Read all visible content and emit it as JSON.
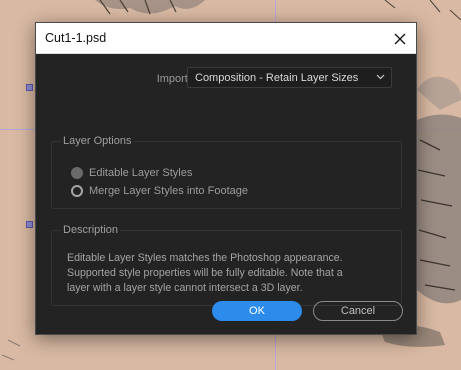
{
  "dialog": {
    "title": "Cut1-1.psd",
    "close_icon": "close-icon",
    "import_kind": {
      "label": "Import Kind:",
      "selected": "Composition - Retain Layer Sizes",
      "chevron_icon": "chevron-down-icon"
    },
    "layer_options": {
      "title": "Layer Options",
      "options": [
        {
          "label": "Editable Layer Styles",
          "state": "disabled-selected"
        },
        {
          "label": "Merge Layer Styles into Footage",
          "state": "unselected"
        }
      ]
    },
    "description": {
      "title": "Description",
      "lines": [
        "Editable Layer Styles matches the Photoshop appearance.",
        "Supported style properties will be fully editable. Note that a",
        "layer with a layer style cannot intersect a 3D layer."
      ]
    },
    "buttons": {
      "ok": "OK",
      "cancel": "Cancel"
    }
  },
  "colors": {
    "canvas_background": "#d9b9a3",
    "guide_lines": "#b3a8d8",
    "dialog_background": "#232323",
    "primary_button": "#2d8ceb"
  }
}
